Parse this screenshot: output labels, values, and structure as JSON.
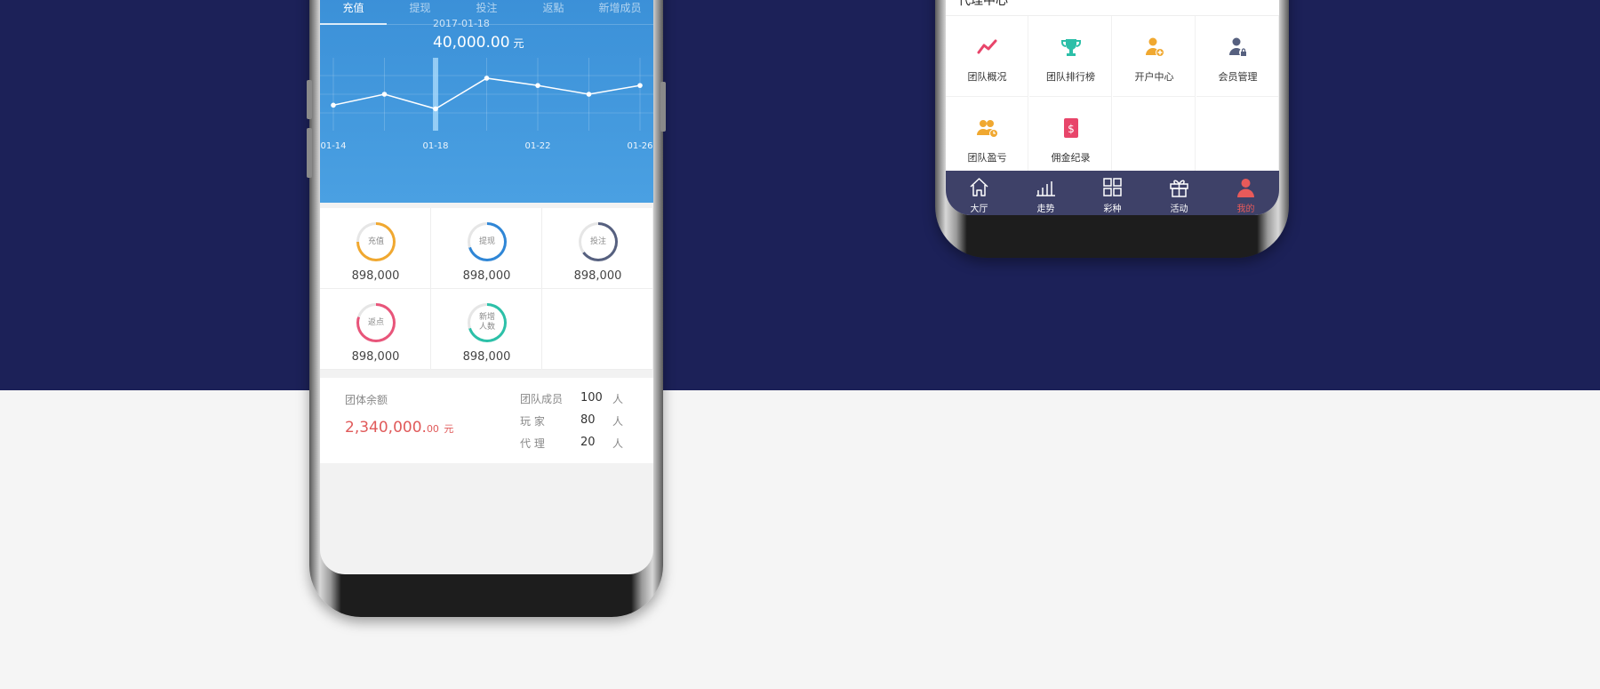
{
  "left_phone": {
    "tabs": [
      "充值",
      "提现",
      "投注",
      "返點",
      "新增成员"
    ],
    "active_tab": 0,
    "chart": {
      "date": "2017-01-18",
      "amount": "40,000.00",
      "unit": "元"
    },
    "stats": [
      {
        "label": "充值",
        "value": "898,000",
        "color": "#f0a830",
        "progress": 0.75
      },
      {
        "label": "提现",
        "value": "898,000",
        "color": "#2f86d6",
        "progress": 0.7
      },
      {
        "label": "投注",
        "value": "898,000",
        "color": "#56607f",
        "progress": 0.65
      },
      {
        "label": "返点",
        "value": "898,000",
        "color": "#e8557a",
        "progress": 0.8
      },
      {
        "label": "新增\n人数",
        "value": "898,000",
        "color": "#2cc0a8",
        "progress": 0.7
      }
    ],
    "summary": {
      "label": "团体余额",
      "amount_main": "2,340,000.",
      "amount_dec": "00",
      "amount_unit": "元",
      "members": [
        {
          "name": "团队成员",
          "count": "100",
          "unit": "人"
        },
        {
          "name": "玩  家",
          "count": "80",
          "unit": "人"
        },
        {
          "name": "代  理",
          "count": "20",
          "unit": "人"
        }
      ]
    }
  },
  "chart_data": {
    "type": "line",
    "x": [
      "01-14",
      "01-15",
      "01-16",
      "01-17",
      "01-18",
      "01-19",
      "01-20",
      "01-21",
      "01-22",
      "01-23",
      "01-24",
      "01-25",
      "01-26"
    ],
    "x_tick_labels": [
      "01-14",
      "01-18",
      "01-22",
      "01-26"
    ],
    "y": [
      35,
      null,
      50,
      null,
      30,
      null,
      72,
      null,
      62,
      null,
      50,
      null,
      62
    ],
    "highlight_x": "01-18",
    "highlight_value": "40,000.00",
    "grid": true
  },
  "right_phone": {
    "header_title": "代理中心",
    "grid_items": [
      {
        "label": "团队概况",
        "icon": "trend-line-icon",
        "color": "#e8456a"
      },
      {
        "label": "团队排行榜",
        "icon": "trophy-icon",
        "color": "#2cbfa8"
      },
      {
        "label": "开户中心",
        "icon": "user-add-icon",
        "color": "#f0a830"
      },
      {
        "label": "会员管理",
        "icon": "user-lock-icon",
        "color": "#56607f"
      },
      {
        "label": "团队盈亏",
        "icon": "team-clock-icon",
        "color": "#f0a830"
      },
      {
        "label": "佣金纪录",
        "icon": "red-envelope-icon",
        "color": "#e8456a"
      }
    ],
    "tabbar": [
      {
        "label": "大厅",
        "icon": "home-icon"
      },
      {
        "label": "走势",
        "icon": "bar-chart-icon"
      },
      {
        "label": "彩种",
        "icon": "grid-icon"
      },
      {
        "label": "活动",
        "icon": "gift-icon"
      },
      {
        "label": "我的",
        "icon": "user-icon"
      }
    ],
    "active_tab": 4,
    "active_color": "#e85a5a"
  }
}
